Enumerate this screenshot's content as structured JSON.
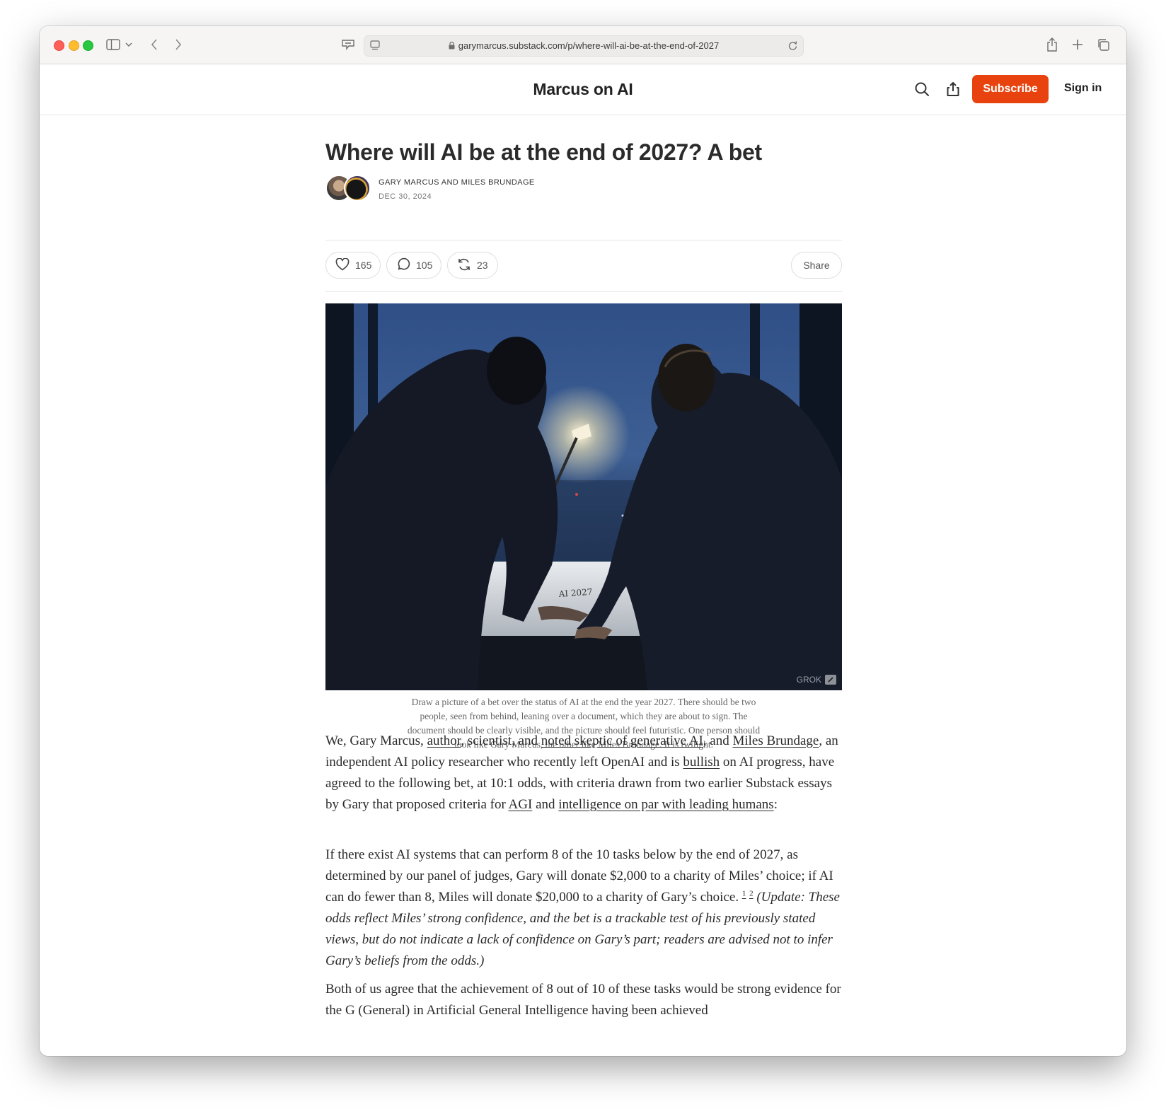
{
  "browser": {
    "url": "garymarcus.substack.com/p/where-will-ai-be-at-the-end-of-2027"
  },
  "site": {
    "title": "Marcus on AI",
    "subscribe_label": "Subscribe",
    "signin_label": "Sign in"
  },
  "post": {
    "title": "Where will AI be at the end of 2027? A bet",
    "authors": "GARY MARCUS AND MILES BRUNDAGE",
    "date": "DEC 30, 2024",
    "likes": "165",
    "comments": "105",
    "restacks": "23",
    "share_label": "Share",
    "image_badge": "GROK",
    "caption": "Draw a picture of a bet over the status of AI at the end the year 2027. There should be two people, seen from behind, leaning over a document, which they are about to sign. The document should be clearly visible, and the picture should feel futuristic. One person should look like Gary Marcus, the other like Miles Brundage. It is twilight."
  },
  "paragraph1": {
    "t1": "We, Gary Marcus, ",
    "l1": "author",
    "t2": ", scientist, and ",
    "l2": "noted skeptic of generative AI",
    "t3": ", and ",
    "l3": "Miles Brundage",
    "t4": ", an independent AI policy researcher who recently left OpenAI and is ",
    "l4": "bullish",
    "t5": " on AI progress, have agreed to the following bet, at 10:1 odds, with criteria drawn from two earlier Substack essays by Gary that proposed criteria for ",
    "l5": "AGI",
    "t6": " and ",
    "l6": "intelligence on par with leading humans",
    "t7": ":"
  },
  "paragraph2": {
    "t1": "If there exist AI systems that can perform 8 of the 10 tasks below by the end of 2027, as determined by our panel of judges, Gary will donate $2,000 to a charity of Miles’ choice; if AI can do fewer than 8, Miles will donate $20,000 to a charity of Gary’s choice. ",
    "fn1": "1",
    "fn2": "2",
    "italic": "(Update: These odds reflect Miles’ strong confidence, and the bet is a trackable test of his previously stated views, but do not indicate a lack of confidence on Gary’s part; readers are advised not to infer Gary’s beliefs from the odds.)"
  },
  "paragraph3": {
    "text": "Both of us agree that the achievement of 8 out of 10 of these tasks would be strong evidence for the G (General) in Artificial General Intelligence having been achieved"
  }
}
